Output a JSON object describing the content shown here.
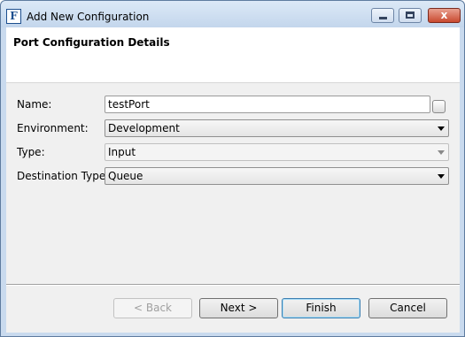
{
  "window": {
    "title": "Add New Configuration",
    "app_icon_letter": "F"
  },
  "header": {
    "title": "Port Configuration Details"
  },
  "form": {
    "name": {
      "label": "Name:",
      "value": "testPort"
    },
    "environment": {
      "label": "Environment:",
      "value": "Development"
    },
    "type": {
      "label": "Type:",
      "value": "Input"
    },
    "destination_type": {
      "label": "Destination Type:",
      "value": "Queue"
    }
  },
  "buttons": {
    "back": "< Back",
    "next": "Next >",
    "finish": "Finish",
    "cancel": "Cancel"
  },
  "caption": {
    "close_glyph": "x"
  }
}
